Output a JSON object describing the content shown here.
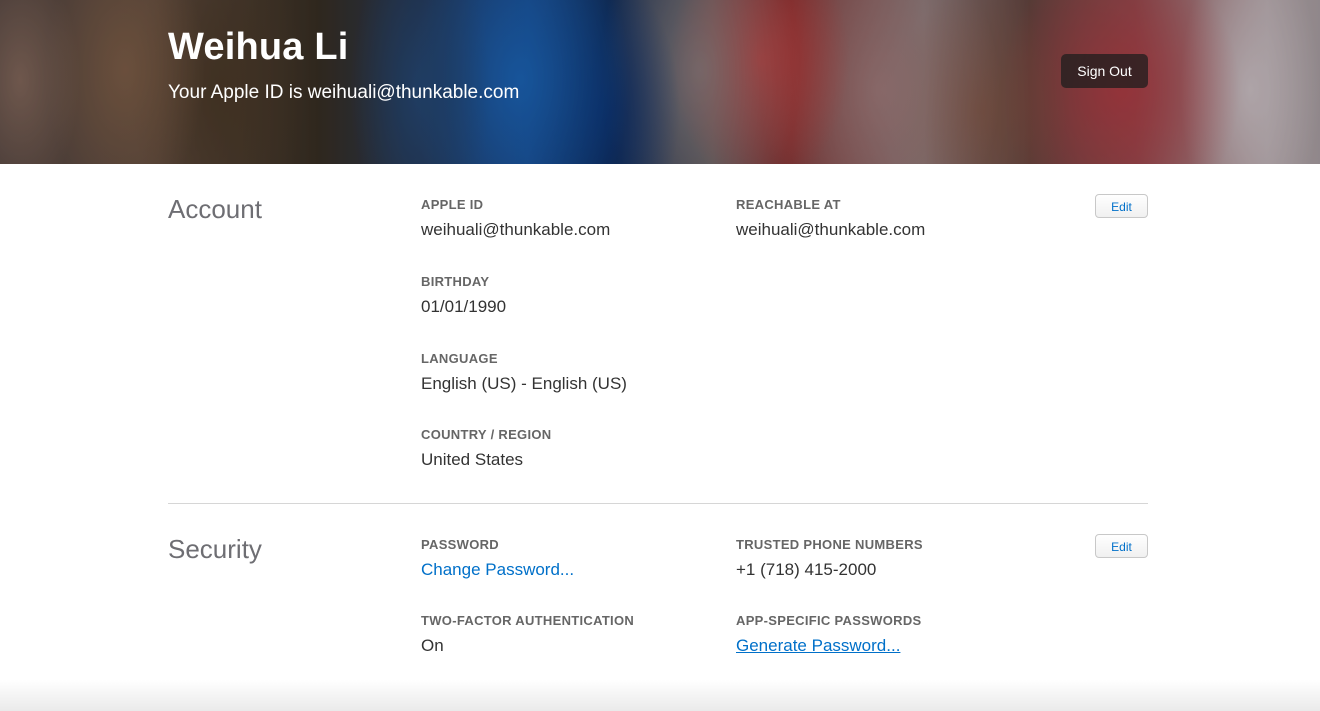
{
  "header": {
    "name": "Weihua Li",
    "subtitle": "Your Apple ID is weihuali@thunkable.com",
    "sign_out_label": "Sign Out"
  },
  "account": {
    "title": "Account",
    "edit_label": "Edit",
    "apple_id_label": "APPLE ID",
    "apple_id_value": "weihuali@thunkable.com",
    "reachable_label": "REACHABLE AT",
    "reachable_value": "weihuali@thunkable.com",
    "birthday_label": "BIRTHDAY",
    "birthday_value": "01/01/1990",
    "language_label": "LANGUAGE",
    "language_value": "English (US) - English (US)",
    "country_label": "COUNTRY / REGION",
    "country_value": "United States"
  },
  "security": {
    "title": "Security",
    "edit_label": "Edit",
    "password_label": "PASSWORD",
    "password_link": "Change Password...",
    "trusted_label": "TRUSTED PHONE NUMBERS",
    "trusted_value": "+1 (718) 415-2000",
    "two_factor_label": "TWO-FACTOR AUTHENTICATION",
    "two_factor_value": "On",
    "app_specific_label": "APP-SPECIFIC PASSWORDS",
    "app_specific_link": "Generate Password..."
  },
  "colors": {
    "link": "#0070c9",
    "label": "#666666",
    "section_title": "#6e6e73"
  }
}
